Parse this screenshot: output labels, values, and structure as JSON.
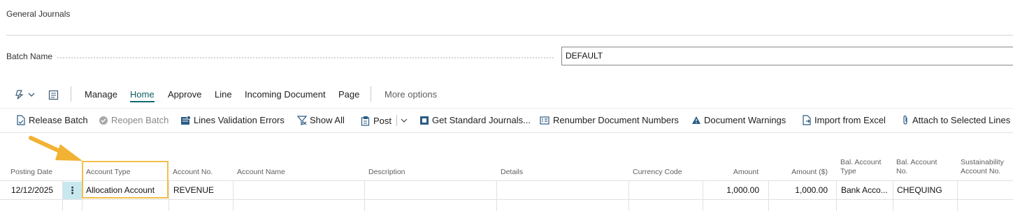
{
  "page": {
    "title": "General Journals"
  },
  "batch": {
    "label": "Batch Name",
    "value": "DEFAULT"
  },
  "menu": {
    "icons": [
      "copilot-icon",
      "chevron-down-icon",
      "edit-list-icon"
    ],
    "items": [
      "Manage",
      "Home",
      "Approve",
      "Line",
      "Incoming Document",
      "Page"
    ],
    "active": "Home",
    "more": "More options"
  },
  "actions": {
    "release_batch": "Release Batch",
    "reopen_batch": "Reopen Batch",
    "lines_validation_errors": "Lines Validation Errors",
    "show_all": "Show All",
    "post": "Post",
    "get_standard_journals": "Get Standard Journals...",
    "renumber_document_numbers": "Renumber Document Numbers",
    "document_warnings": "Document Warnings",
    "import_from_excel": "Import from Excel",
    "attach_to_selected_lines": "Attach to Selected Lines"
  },
  "colors": {
    "accent": "#0f6b73",
    "highlight": "#f3be4a",
    "arrow": "#f2b233",
    "selected_cell": "#c8e8ef"
  },
  "grid": {
    "columns": {
      "posting_date": "Posting Date",
      "account_type": "Account Type",
      "account_no": "Account No.",
      "account_name": "Account Name",
      "description": "Description",
      "details": "Details",
      "currency_code": "Currency Code",
      "amount": "Amount",
      "amount_lcy": "Amount ($)",
      "bal_account_type_1": "Bal. Account",
      "bal_account_type_2": "Type",
      "bal_account_no_1": "Bal. Account",
      "bal_account_no_2": "No.",
      "sustainability_1": "Sustainability",
      "sustainability_2": "Account No."
    },
    "row": {
      "posting_date": "12/12/2025",
      "row_menu": "⋮",
      "account_type": "Allocation Account",
      "account_no": "REVENUE",
      "account_name": "",
      "description": "",
      "details": "",
      "currency_code": "",
      "amount": "1,000.00",
      "amount_lcy": "1,000.00",
      "bal_account_type": "Bank Acco...",
      "bal_account_no": "CHEQUING",
      "sustainability_account_no": ""
    }
  }
}
